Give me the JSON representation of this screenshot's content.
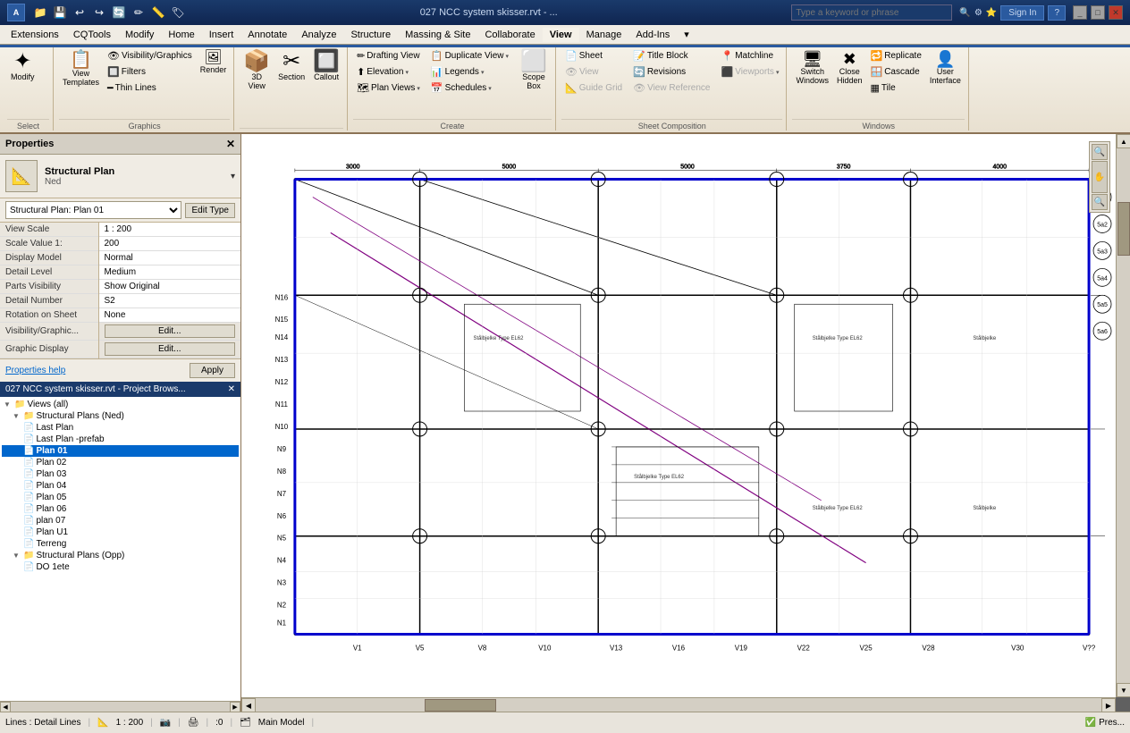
{
  "titlebar": {
    "title": "027 NCC system skisser.rvt - ...",
    "search_placeholder": "Type a keyword or phrase",
    "sign_in": "Sign In",
    "help": "?"
  },
  "menubar": {
    "items": [
      "Extensions",
      "CQTools",
      "Modify",
      "Home",
      "Insert",
      "Annotate",
      "Analyze",
      "Structure",
      "Massing & Site",
      "Collaborate",
      "View",
      "Manage",
      "Add-Ins",
      "▾"
    ]
  },
  "ribbon": {
    "active_tab": "View",
    "tabs": [
      "Modify",
      "Home",
      "Insert",
      "Annotate",
      "Analyze",
      "Structure",
      "Massing & Site",
      "Collaborate",
      "View",
      "Manage",
      "Add-Ins",
      "▾"
    ],
    "groups": {
      "select": {
        "label": "Select",
        "buttons": [
          {
            "icon": "✦",
            "label": "Modify",
            "big": true
          }
        ]
      },
      "graphics": {
        "label": "Graphics",
        "buttons": [
          {
            "icon": "🖼",
            "label": "View\nTemplates"
          },
          {
            "icon": "📋",
            "label": ""
          },
          {
            "icon": "🔲",
            "label": ""
          },
          {
            "icon": "🔧",
            "label": "Render"
          },
          {
            "icon": "📦",
            "label": "3D\nView"
          },
          {
            "icon": "✂",
            "label": "Section"
          },
          {
            "icon": "📞",
            "label": "Callout"
          }
        ]
      },
      "create": {
        "label": "Create",
        "items_col1": [
          {
            "icon": "✏",
            "label": "Drafting View"
          },
          {
            "icon": "⬆",
            "label": "Elevation ▾"
          },
          {
            "icon": "🗺",
            "label": "Plan Views ▾"
          }
        ],
        "items_col2": [
          {
            "icon": "📋",
            "label": "Duplicate View ▾"
          },
          {
            "icon": "📊",
            "label": "Legends ▾"
          },
          {
            "icon": "📅",
            "label": "Schedules ▾"
          }
        ],
        "scope_box": {
          "icon": "⬜",
          "label": "Scope\nBox"
        }
      },
      "sheet_comp": {
        "label": "Sheet Composition",
        "items_col1": [
          {
            "icon": "📄",
            "label": "Sheet",
            "enabled": true
          },
          {
            "icon": "👁",
            "label": "View",
            "enabled": false
          },
          {
            "icon": "📐",
            "label": "Guide Grid",
            "enabled": false
          }
        ],
        "items_col2": [
          {
            "icon": "📝",
            "label": "Title Block",
            "enabled": true
          },
          {
            "icon": "🔄",
            "label": "Revisions",
            "enabled": true
          },
          {
            "icon": "👁",
            "label": "View Reference",
            "enabled": false
          }
        ],
        "items_col3": [
          {
            "icon": "📍",
            "label": "Matchline",
            "enabled": true
          },
          {
            "icon": "⬛",
            "label": "Viewports ▾",
            "enabled": false
          }
        ]
      },
      "windows": {
        "label": "Windows",
        "buttons": [
          {
            "icon": "🔁",
            "label": "Replicate"
          },
          {
            "icon": "🪟",
            "label": "Cascade"
          },
          {
            "icon": "▦",
            "label": "Tile"
          },
          {
            "icon": "🖥",
            "label": "Switch\nWindows"
          },
          {
            "icon": "✖",
            "label": "Close\nHidden"
          },
          {
            "icon": "👤",
            "label": "User\nInterface"
          }
        ]
      }
    }
  },
  "properties": {
    "panel_title": "Properties",
    "type_icon": "📄",
    "type_name": "Structural Plan",
    "type_sub": "Ned",
    "selector_value": "Structural Plan: Plan 01",
    "edit_type_label": "Edit Type",
    "rows": [
      {
        "label": "View Scale",
        "value": "1 : 200"
      },
      {
        "label": "Scale Value 1:",
        "value": "200"
      },
      {
        "label": "Display Model",
        "value": "Normal"
      },
      {
        "label": "Detail Level",
        "value": "Medium"
      },
      {
        "label": "Parts Visibility",
        "value": "Show Original"
      },
      {
        "label": "Detail Number",
        "value": "S2"
      },
      {
        "label": "Rotation on Sheet",
        "value": "None"
      },
      {
        "label": "Visibility/Graphic...",
        "value": "Edit..."
      },
      {
        "label": "Graphic Display",
        "value": "Edit..."
      }
    ],
    "help_link": "Properties help",
    "apply_label": "Apply"
  },
  "project_browser": {
    "title": "027 NCC system skisser.rvt - Project Brows...",
    "tree": [
      {
        "level": 0,
        "icon": "▼",
        "label": "Views (all)",
        "type": "group"
      },
      {
        "level": 1,
        "icon": "▼",
        "label": "Structural Plans (Ned)",
        "type": "group"
      },
      {
        "level": 2,
        "icon": "",
        "label": "Last Plan",
        "type": "item"
      },
      {
        "level": 2,
        "icon": "",
        "label": "Last Plan -prefab",
        "type": "item"
      },
      {
        "level": 2,
        "icon": "",
        "label": "Plan 01",
        "type": "item",
        "bold": true,
        "selected": true
      },
      {
        "level": 2,
        "icon": "",
        "label": "Plan 02",
        "type": "item"
      },
      {
        "level": 2,
        "icon": "",
        "label": "Plan 03",
        "type": "item"
      },
      {
        "level": 2,
        "icon": "",
        "label": "Plan 04",
        "type": "item"
      },
      {
        "level": 2,
        "icon": "",
        "label": "Plan 05",
        "type": "item"
      },
      {
        "level": 2,
        "icon": "",
        "label": "Plan 06",
        "type": "item"
      },
      {
        "level": 2,
        "icon": "",
        "label": "plan 07",
        "type": "item"
      },
      {
        "level": 2,
        "icon": "",
        "label": "Plan U1",
        "type": "item"
      },
      {
        "level": 2,
        "icon": "",
        "label": "Terreng",
        "type": "item"
      },
      {
        "level": 1,
        "icon": "▼",
        "label": "Structural Plans (Opp)",
        "type": "group"
      },
      {
        "level": 2,
        "icon": "",
        "label": "DO 1ete",
        "type": "item"
      }
    ]
  },
  "canvas": {
    "scale_display": "1 : 200"
  },
  "statusbar": {
    "line_type": "Lines : Detail Lines",
    "workset": "Main Model",
    "coordinates": ":0",
    "active_workset": "Main Model",
    "preselect": "Pres..."
  }
}
